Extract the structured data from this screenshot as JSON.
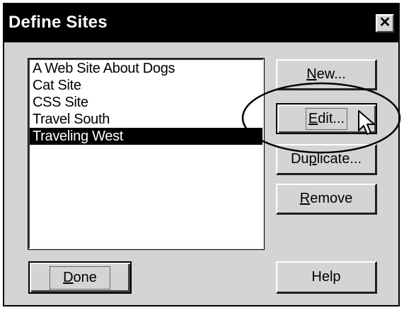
{
  "window": {
    "title": "Define Sites",
    "close_glyph": "✕"
  },
  "sites_list": {
    "items": [
      {
        "label": "A Web Site About Dogs",
        "selected": false
      },
      {
        "label": "Cat Site",
        "selected": false
      },
      {
        "label": "CSS Site",
        "selected": false
      },
      {
        "label": "Travel South",
        "selected": false
      },
      {
        "label": "Traveling West",
        "selected": true
      }
    ]
  },
  "buttons": {
    "new": {
      "mnemonic": "N",
      "rest": "ew..."
    },
    "edit": {
      "mnemonic": "E",
      "rest": "dit..."
    },
    "duplicate": {
      "pre": "Du",
      "mnemonic": "p",
      "rest": "licate..."
    },
    "remove": {
      "mnemonic": "R",
      "rest": "emove"
    },
    "done": {
      "mnemonic": "D",
      "rest": "one"
    },
    "help": {
      "label": "Help"
    }
  },
  "colors": {
    "dialog_bg": "#d4d4d4",
    "titlebar_bg": "#000000",
    "selection_bg": "#000000"
  },
  "icons": [
    "close-icon",
    "pointer-cursor-icon",
    "highlight-ellipse"
  ]
}
